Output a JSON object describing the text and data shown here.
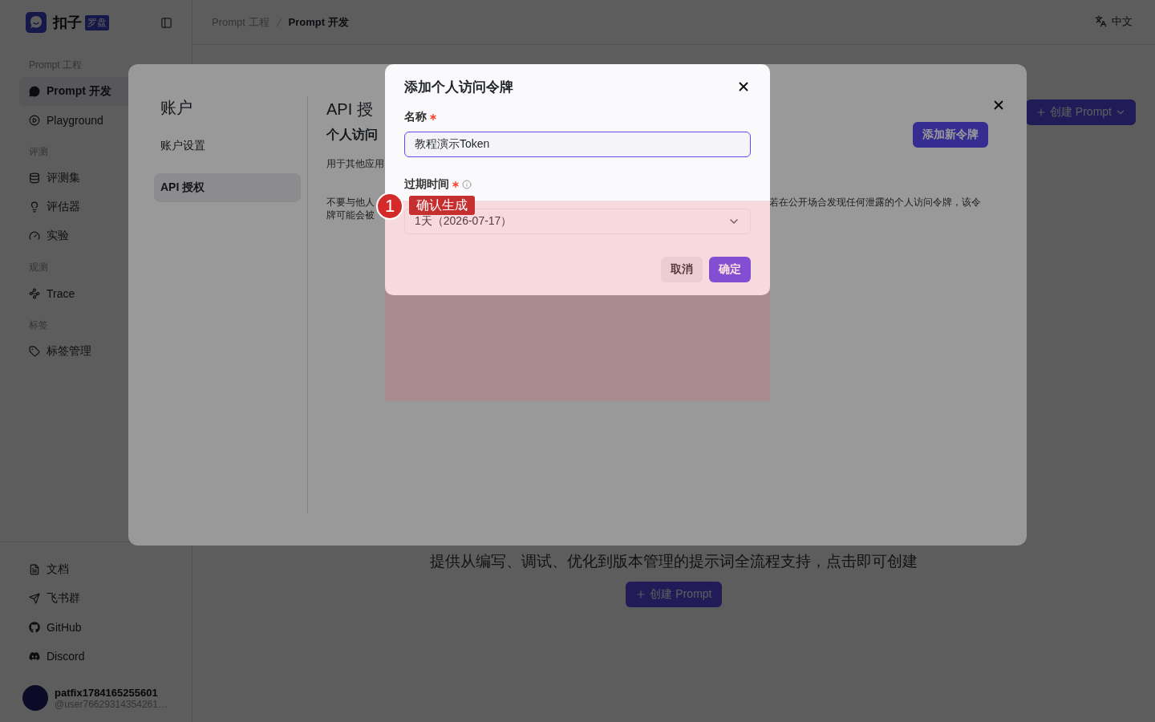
{
  "sidebar": {
    "brand": "扣子",
    "brand_badge": "罗盘",
    "sections": [
      {
        "title": "Prompt 工程",
        "items": [
          {
            "label": "Prompt 开发",
            "selected": true
          },
          {
            "label": "Playground",
            "selected": false
          }
        ]
      },
      {
        "title": "评测",
        "items": [
          {
            "label": "评测集",
            "selected": false
          },
          {
            "label": "评估器",
            "selected": false
          },
          {
            "label": "实验",
            "selected": false
          }
        ]
      },
      {
        "title": "观测",
        "items": [
          {
            "label": "Trace",
            "selected": false
          }
        ]
      },
      {
        "title": "标签",
        "items": [
          {
            "label": "标签管理",
            "selected": false
          }
        ]
      }
    ],
    "footer_links": [
      "文档",
      "飞书群",
      "GitHub",
      "Discord"
    ],
    "user": {
      "name": "patfix1784165255601",
      "handle": "@user76629314354261…"
    }
  },
  "header": {
    "breadcrumb": [
      "Prompt 工程",
      "Prompt 开发"
    ],
    "language": "中文"
  },
  "main": {
    "create_button": "创建 Prompt",
    "description": "提供从编写、调试、优化到版本管理的提示词全流程支持，点击即可创建",
    "empty_create_button": "创建 Prompt"
  },
  "settings_modal": {
    "title": "账户",
    "nav": [
      {
        "label": "账户设置",
        "selected": false
      },
      {
        "label": "API 授权",
        "selected": true
      }
    ],
    "heading": "API 授",
    "subheading": "个人访问",
    "add_button": "添加新令牌",
    "description": "用于其他应用",
    "warning_left": [
      "不要与他人",
      "牌可能会被"
    ],
    "warning_right": "若在公开场合发现任何泄露的个人访问令牌，该令"
  },
  "dialog": {
    "title": "添加个人访问令牌",
    "fields": [
      {
        "kind": "input",
        "label": "名称",
        "required": true,
        "focused": true,
        "value": "教程演示Token"
      },
      {
        "kind": "select",
        "label": "过期时间",
        "required": true,
        "info": true,
        "focused": false,
        "value": "1天（2026-07-17）"
      }
    ],
    "buttons": [
      {
        "label": "取消",
        "kind": "secondary"
      },
      {
        "label": "确定",
        "kind": "primary"
      }
    ]
  },
  "tutorial": {
    "step": "1",
    "label": "确认生成"
  }
}
